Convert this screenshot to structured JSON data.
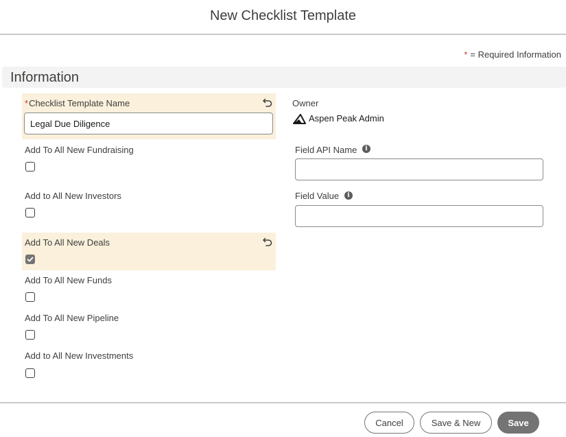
{
  "header": {
    "title": "New Checklist Template"
  },
  "required_info": {
    "star": "*",
    "text": "= Required Information"
  },
  "section": {
    "title": "Information"
  },
  "fields": {
    "template_name": {
      "required_mark": "*",
      "label": "Checklist Template Name",
      "value": "Legal Due Diligence"
    },
    "owner": {
      "label": "Owner",
      "value": "Aspen Peak Admin"
    },
    "field_api_name": {
      "label": "Field API Name",
      "value": ""
    },
    "field_value": {
      "label": "Field Value",
      "value": ""
    },
    "info_glyph": "i",
    "add_fundraising": {
      "label": "Add To All New Fundraising",
      "checked": false
    },
    "add_investors": {
      "label": "Add to All New Investors",
      "checked": false
    },
    "add_deals": {
      "label": "Add To All New Deals",
      "checked": true
    },
    "add_funds": {
      "label": "Add To All New Funds",
      "checked": false
    },
    "add_pipeline": {
      "label": "Add To All New Pipeline",
      "checked": false
    },
    "add_investments": {
      "label": "Add to All New Investments",
      "checked": false
    }
  },
  "footer": {
    "cancel": "Cancel",
    "save_new": "Save & New",
    "save": "Save"
  },
  "icons": {
    "undo": "undo-icon",
    "info": "info-icon",
    "check": "checkmark-icon",
    "owner_logo": "mountain-logo-icon"
  },
  "colors": {
    "highlight": "#faf0dc",
    "required": "#c23934",
    "brand_button": "#747474",
    "section_bg": "#f3f3f3"
  }
}
